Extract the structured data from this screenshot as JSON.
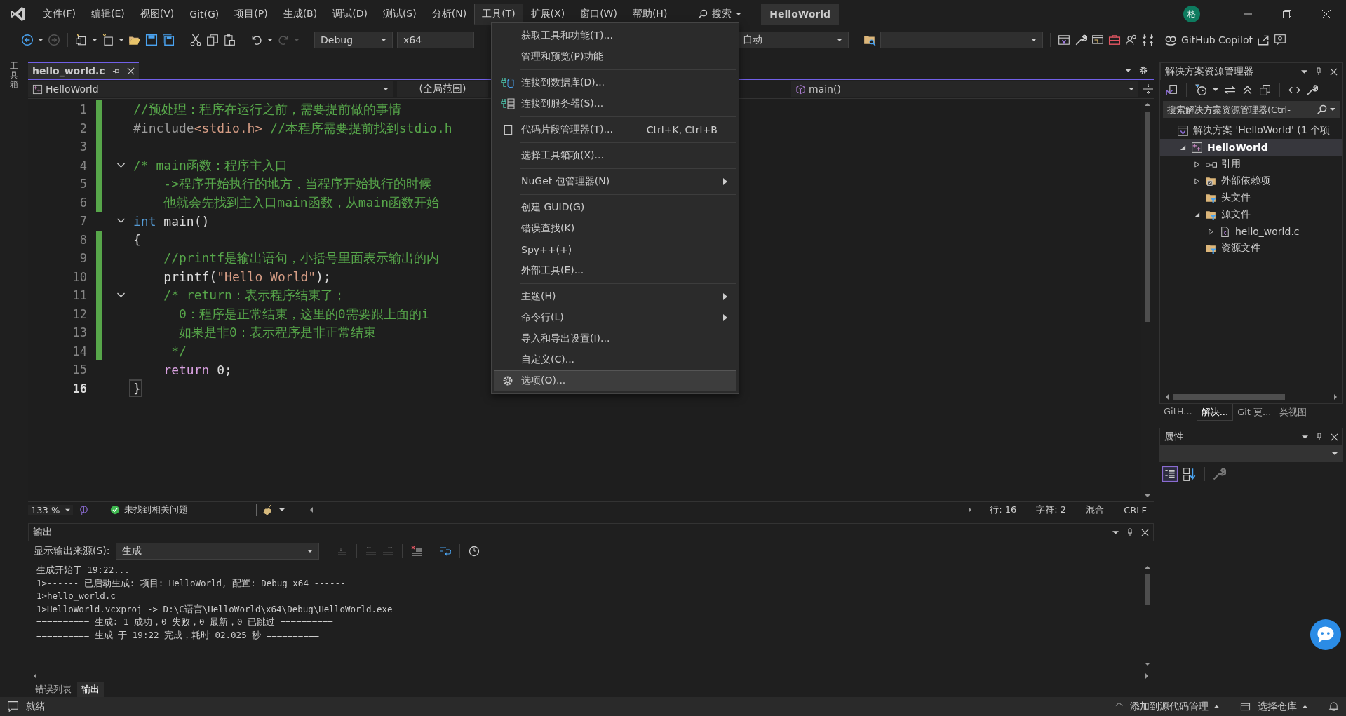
{
  "menubar": {
    "items": [
      {
        "label": "文件(F)",
        "selected": false
      },
      {
        "label": "编辑(E)",
        "selected": false
      },
      {
        "label": "视图(V)",
        "selected": false
      },
      {
        "label": "Git(G)",
        "selected": false
      },
      {
        "label": "项目(P)",
        "selected": false
      },
      {
        "label": "生成(B)",
        "selected": false
      },
      {
        "label": "调试(D)",
        "selected": false
      },
      {
        "label": "测试(S)",
        "selected": false
      },
      {
        "label": "分析(N)",
        "selected": false
      },
      {
        "label": "工具(T)",
        "selected": true
      },
      {
        "label": "扩展(X)",
        "selected": false
      },
      {
        "label": "窗口(W)",
        "selected": false
      },
      {
        "label": "帮助(H)",
        "selected": false
      }
    ],
    "search": "搜索",
    "solution_title": "HelloWorld",
    "avatar": "格"
  },
  "toolbar": {
    "configuration": "Debug",
    "platform": "x64",
    "startup": "自动",
    "copilot": "GitHub Copilot"
  },
  "side_strip": {
    "label": "工具箱"
  },
  "editor": {
    "tabs": [
      {
        "label": "hello_world.c",
        "selected": true
      }
    ],
    "nav": {
      "project": "HelloWorld",
      "scope": "(全局范围)",
      "member": "main()"
    },
    "lines": [
      {
        "number": "1",
        "changed": true,
        "fold": false,
        "current": false,
        "tokens": [
          {
            "kind": "comment",
            "text": "//预处理：程序在运行之前，需要提前做的事情"
          }
        ]
      },
      {
        "number": "2",
        "changed": true,
        "fold": false,
        "current": false,
        "tokens": [
          {
            "kind": "preprocessor",
            "text": "#include"
          },
          {
            "kind": "string",
            "text": "<stdio.h>"
          },
          {
            "kind": "comment",
            "text": " //本程序需要提前找到stdio.h"
          }
        ]
      },
      {
        "number": "3",
        "changed": true,
        "fold": false,
        "current": false
      },
      {
        "number": "4",
        "changed": true,
        "fold": true,
        "current": false,
        "tokens": [
          {
            "kind": "comment",
            "text": "/* main函数：程序主入口"
          }
        ]
      },
      {
        "number": "5",
        "changed": true,
        "fold": false,
        "current": false,
        "tokens": [
          {
            "kind": "comment",
            "text": "    ->程序开始执行的地方，当程序开始执行的时候"
          }
        ]
      },
      {
        "number": "6",
        "changed": true,
        "fold": false,
        "current": false,
        "tokens": [
          {
            "kind": "comment",
            "text": "    他就会先找到主入口main函数，从main函数开始"
          }
        ]
      },
      {
        "number": "7",
        "changed": false,
        "fold": true,
        "current": false,
        "tokens": [
          {
            "kind": "keyword",
            "text": "int"
          },
          {
            "kind": "plain",
            "text": " main()"
          }
        ]
      },
      {
        "number": "8",
        "changed": true,
        "fold": false,
        "current": false,
        "tokens": [
          {
            "kind": "plain",
            "text": "{"
          }
        ]
      },
      {
        "number": "9",
        "changed": true,
        "fold": false,
        "current": false,
        "tokens": [
          {
            "kind": "comment",
            "text": "    //printf是输出语句，小括号里面表示输出的内"
          }
        ]
      },
      {
        "number": "10",
        "changed": true,
        "fold": false,
        "current": false,
        "tokens": [
          {
            "kind": "plain",
            "text": "    printf("
          },
          {
            "kind": "string",
            "text": "\"Hello World\""
          },
          {
            "kind": "plain",
            "text": ");"
          }
        ]
      },
      {
        "number": "11",
        "changed": true,
        "fold": true,
        "current": false,
        "tokens": [
          {
            "kind": "comment",
            "text": "    /* return：表示程序结束了；"
          }
        ]
      },
      {
        "number": "12",
        "changed": true,
        "fold": false,
        "current": false,
        "tokens": [
          {
            "kind": "comment",
            "text": "      0：程序是正常结束，这里的0需要跟上面的i"
          }
        ]
      },
      {
        "number": "13",
        "changed": true,
        "fold": false,
        "current": false,
        "tokens": [
          {
            "kind": "comment",
            "text": "      如果是非0：表示程序是非正常结束"
          }
        ]
      },
      {
        "number": "14",
        "changed": true,
        "fold": false,
        "current": false,
        "tokens": [
          {
            "kind": "comment",
            "text": "     */"
          }
        ]
      },
      {
        "number": "15",
        "changed": false,
        "fold": false,
        "current": false,
        "tokens": [
          {
            "kind": "control",
            "text": "    return"
          },
          {
            "kind": "plain",
            "text": " 0;"
          }
        ]
      },
      {
        "number": "16",
        "changed": false,
        "fold": false,
        "current": true,
        "tokens": [
          {
            "kind": "plain",
            "text": "}"
          }
        ]
      }
    ],
    "status": {
      "zoom": "133 %",
      "issues": "未找到相关问题",
      "line": "行: 16",
      "char": "字符: 2",
      "mode": "混合",
      "eol": "CRLF"
    }
  },
  "tools_menu": {
    "groups": [
      [
        {
          "label": "获取工具和功能(T)...",
          "submenu": false,
          "selected": false
        },
        {
          "label": "管理和预览(P)功能",
          "submenu": false,
          "selected": false
        }
      ],
      [
        {
          "label": "连接到数据库(D)...",
          "submenu": false,
          "selected": false
        },
        {
          "label": "连接到服务器(S)...",
          "submenu": false,
          "selected": false
        }
      ],
      [
        {
          "label": "代码片段管理器(T)...",
          "shortcut": "Ctrl+K, Ctrl+B",
          "submenu": false,
          "selected": false
        }
      ],
      [
        {
          "label": "选择工具箱项(X)...",
          "submenu": false,
          "selected": false
        }
      ],
      [
        {
          "label": "NuGet 包管理器(N)",
          "submenu": true,
          "selected": false
        }
      ],
      [
        {
          "label": "创建 GUID(G)",
          "submenu": false,
          "selected": false
        },
        {
          "label": "错误查找(K)",
          "submenu": false,
          "selected": false
        },
        {
          "label": "Spy++(+)",
          "submenu": false,
          "selected": false
        },
        {
          "label": "外部工具(E)...",
          "submenu": false,
          "selected": false
        }
      ],
      [
        {
          "label": "主题(H)",
          "submenu": true,
          "selected": false
        },
        {
          "label": "命令行(L)",
          "submenu": true,
          "selected": false
        },
        {
          "label": "导入和导出设置(I)...",
          "submenu": false,
          "selected": false
        },
        {
          "label": "自定义(C)...",
          "submenu": false,
          "selected": false
        },
        {
          "label": "选项(O)...",
          "submenu": false,
          "selected": true
        }
      ]
    ]
  },
  "output": {
    "title": "输出",
    "source_label": "显示输出来源(S):",
    "source": "生成",
    "lines": [
      "生成开始于 19:22...",
      "1>------ 已启动生成: 项目: HelloWorld, 配置: Debug x64 ------",
      "1>hello_world.c",
      "1>HelloWorld.vcxproj -> D:\\C语言\\HelloWorld\\x64\\Debug\\HelloWorld.exe",
      "========== 生成: 1 成功，0 失败，0 最新，0 已跳过 ==========",
      "========== 生成 于 19:22 完成，耗时 02.025 秒 =========="
    ],
    "tabs": [
      {
        "label": "错误列表",
        "selected": false
      },
      {
        "label": "输出",
        "selected": true
      }
    ]
  },
  "solution_explorer": {
    "title": "解决方案资源管理器",
    "search_placeholder": "搜索解决方案资源管理器(Ctrl-",
    "tree": [
      {
        "label": "解决方案 'HelloWorld' (1 个项",
        "selected": false,
        "children": [
          {
            "label": "HelloWorld",
            "expanded": true,
            "selected": true,
            "children": [
              {
                "label": "引用",
                "expanded": false,
                "selected": false
              },
              {
                "label": "外部依赖项",
                "expanded": false,
                "selected": false
              },
              {
                "label": "头文件",
                "selected": false
              },
              {
                "label": "源文件",
                "expanded": true,
                "selected": false,
                "children": [
                  {
                    "label": "hello_world.c",
                    "expanded": false,
                    "selected": false
                  }
                ]
              },
              {
                "label": "资源文件",
                "selected": false
              }
            ]
          }
        ]
      }
    ],
    "tabs": [
      {
        "label": "GitH...",
        "selected": false
      },
      {
        "label": "解决...",
        "selected": true
      },
      {
        "label": "Git 更...",
        "selected": false
      },
      {
        "label": "类视图",
        "selected": false
      }
    ]
  },
  "properties": {
    "title": "属性"
  },
  "status_bar": {
    "message": "就绪",
    "source_control": "添加到源代码管理",
    "repository": "选择仓库"
  }
}
